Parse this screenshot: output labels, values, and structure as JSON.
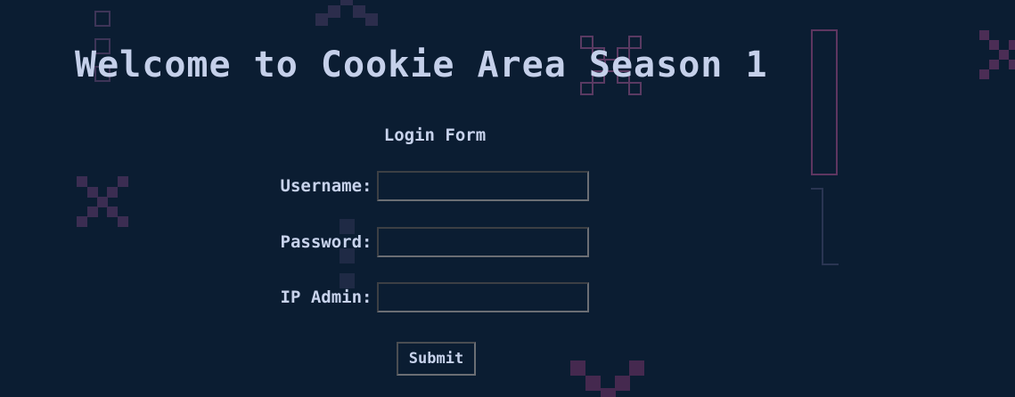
{
  "page": {
    "title": "Welcome to Cookie Area Season 1"
  },
  "form": {
    "heading": "Login Form",
    "username_label": "Username:",
    "username_value": "",
    "password_label": "Password:",
    "password_value": "",
    "ip_admin_label": "IP Admin:",
    "ip_admin_value": "",
    "submit_label": "Submit"
  },
  "colors": {
    "background": "#0b1d32",
    "text": "#c8d3ec",
    "decoration": "#3a2f55",
    "decoration_outline": "#6a3d66"
  }
}
